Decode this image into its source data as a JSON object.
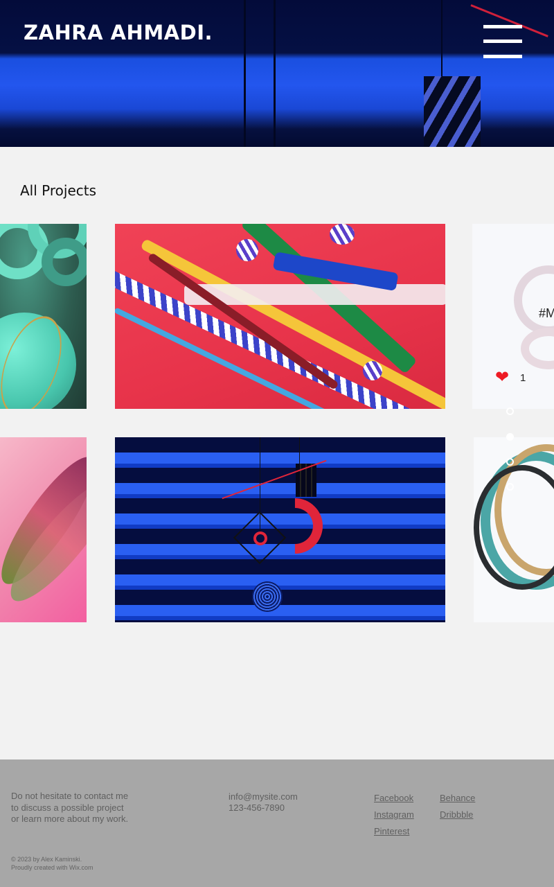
{
  "header": {
    "site_title": "ZAHRA AHMADI.",
    "menu_icon": "hamburger-menu-icon"
  },
  "gallery": {
    "title": "All Projects",
    "items": [
      {
        "name": "green-rings-artwork"
      },
      {
        "name": "red-candy-tubes-artwork"
      },
      {
        "name": "white-swirl-artwork",
        "tag": "#M",
        "likes": "1"
      },
      {
        "name": "pink-ribbon-artwork"
      },
      {
        "name": "blue-stripes-mobile-artwork"
      },
      {
        "name": "glass-loops-artwork"
      }
    ],
    "like_icon": "heart-icon",
    "slide_dots": {
      "count": 4,
      "active_index": 1
    }
  },
  "footer": {
    "blurb": "Do not hesitate to contact me to discuss a possible project or learn more about my work.",
    "copyright_line1": "© 2023 by Alex Kaminski.",
    "copyright_line2": "Proudly created with Wix.com",
    "email": "info@mysite.com",
    "phone": "123-456-7890",
    "links": {
      "facebook": "Facebook",
      "behance": "Behance",
      "instagram": "Instagram",
      "dribbble": "Dribbble",
      "pinterest": "Pinterest"
    }
  },
  "colors": {
    "header_blue": "#2356ee",
    "page_bg": "#f2f2f2",
    "footer_bg": "#a7a7a7",
    "like_red": "#ee1b24"
  }
}
